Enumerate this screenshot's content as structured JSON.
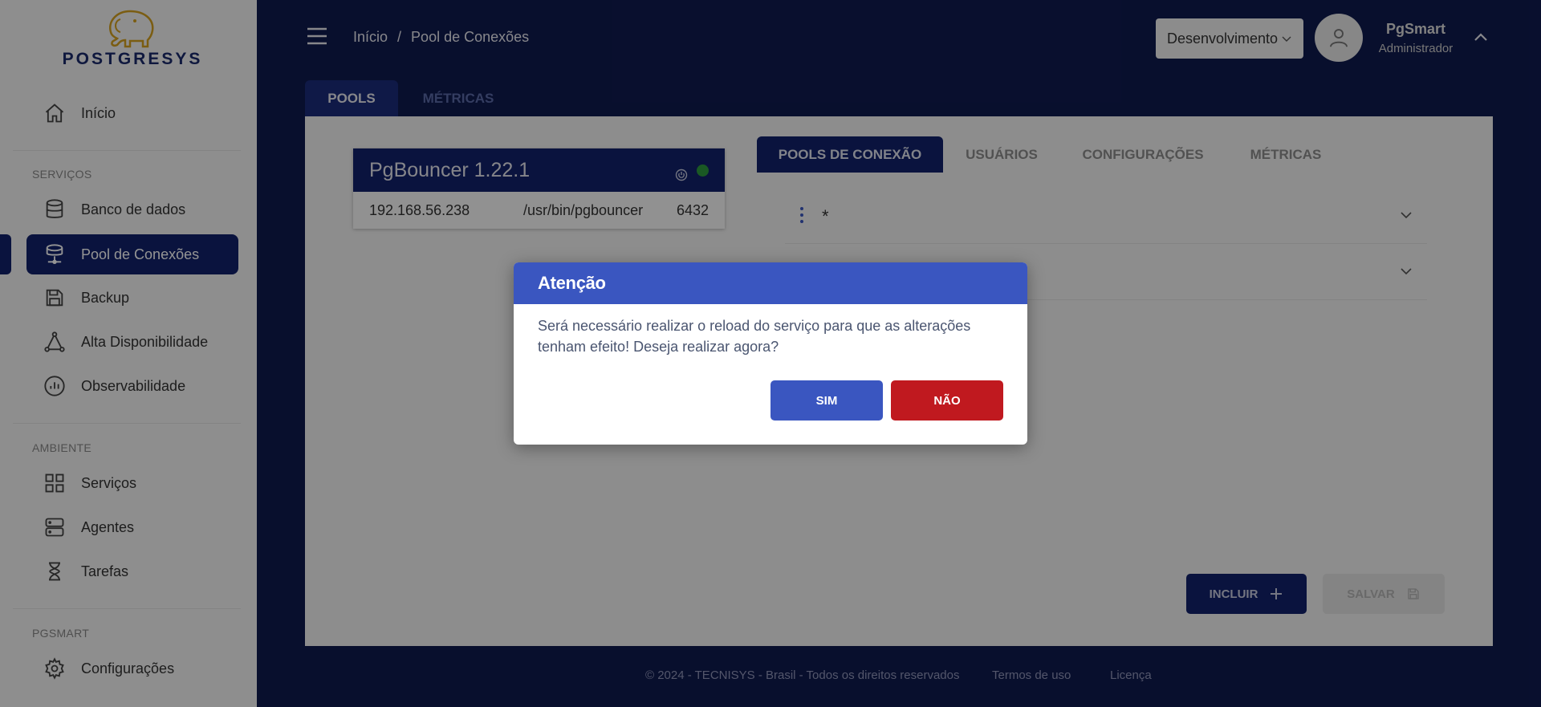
{
  "brand": {
    "logo_text": "POSTGRESYS"
  },
  "sidebar": {
    "home": {
      "label": "Início"
    },
    "sections": {
      "services": "SERVIÇOS",
      "environment": "AMBIENTE",
      "pgsmart": "PGSMART"
    },
    "services_items": [
      {
        "label": "Banco de dados",
        "icon": "database-icon"
      },
      {
        "label": "Pool de Conexões",
        "icon": "connection-pool-icon",
        "active": true
      },
      {
        "label": "Backup",
        "icon": "save-icon"
      },
      {
        "label": "Alta Disponibilidade",
        "icon": "triangle-nodes-icon"
      },
      {
        "label": "Observabilidade",
        "icon": "chart-circle-icon"
      }
    ],
    "environment_items": [
      {
        "label": "Serviços",
        "icon": "grid-icon"
      },
      {
        "label": "Agentes",
        "icon": "server-icon"
      },
      {
        "label": "Tarefas",
        "icon": "hourglass-icon"
      }
    ],
    "pgsmart_items": [
      {
        "label": "Configurações",
        "icon": "gear-icon"
      }
    ]
  },
  "header": {
    "breadcrumb": [
      "Início",
      "Pool de Conexões"
    ],
    "breadcrumb_sep": "/",
    "environment": "Desenvolvimento",
    "user_name": "PgSmart",
    "user_role": "Administrador"
  },
  "main_tabs": [
    "POOLS",
    "MÉTRICAS"
  ],
  "pgbouncer": {
    "title": "PgBouncer 1.22.1",
    "host": "192.168.56.238",
    "path": "/usr/bin/pgbouncer",
    "port": "6432",
    "status_color": "#2e9a3e"
  },
  "sub_tabs": [
    "POOLS DE CONEXÃO",
    "USUÁRIOS",
    "CONFIGURAÇÕES",
    "MÉTRICAS"
  ],
  "pools": [
    {
      "label": "*"
    },
    {
      "label": ""
    }
  ],
  "actions": {
    "add": "INCLUIR",
    "save": "SALVAR"
  },
  "footer": {
    "copyright": "© 2024 - TECNISYS - Brasil - Todos os direitos reservados",
    "terms": "Termos de uso",
    "license": "Licença"
  },
  "dialog": {
    "title": "Atenção",
    "message": "Será necessário realizar o reload do serviço para que as alterações tenham efeito! Deseja realizar agora?",
    "yes": "SIM",
    "no": "NÃO"
  },
  "colors": {
    "primary": "#12226b",
    "dialog_header": "#3a56c0",
    "danger": "#c0191f"
  }
}
